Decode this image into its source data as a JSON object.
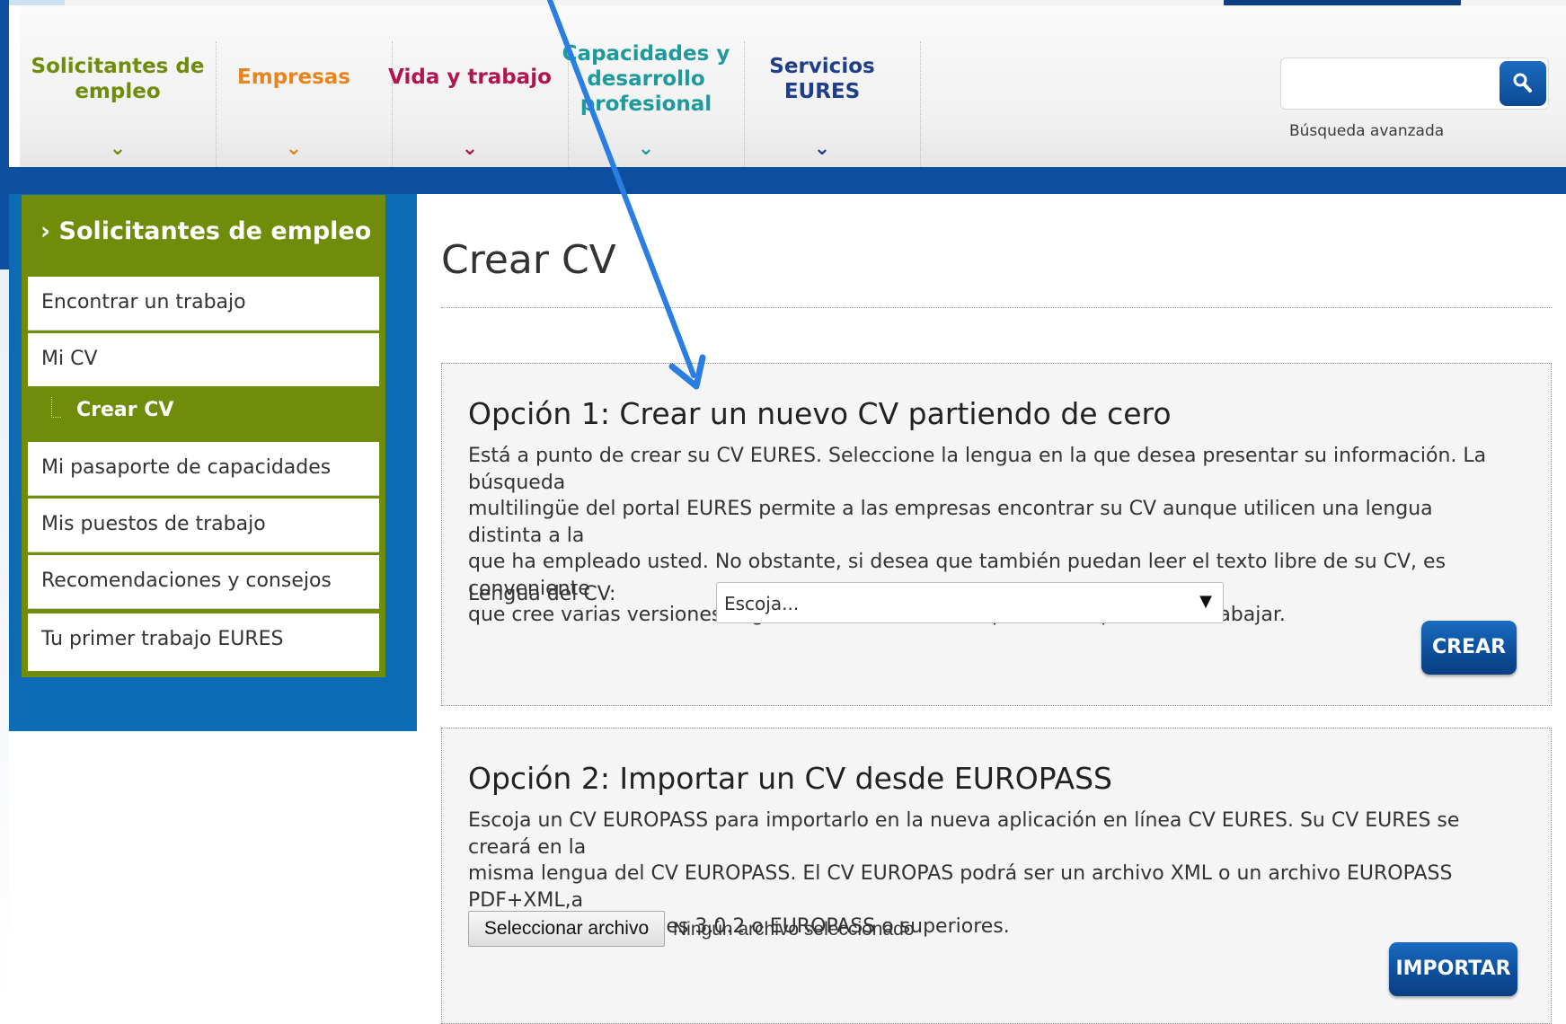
{
  "nav": {
    "items": [
      {
        "label_lines": [
          "Solicitantes de",
          "empleo"
        ],
        "color": "#6f8c0a"
      },
      {
        "label_lines": [
          "Empresas"
        ],
        "color": "#e7841d"
      },
      {
        "label_lines": [
          "Vida y trabajo"
        ],
        "color": "#b0154f"
      },
      {
        "label_lines": [
          "Capacidades y",
          "desarrollo",
          "profesional"
        ],
        "color": "#1f9a9c"
      },
      {
        "label_lines": [
          "Servicios",
          "EURES"
        ],
        "color": "#1e3d8a"
      }
    ],
    "chevron": "⌄"
  },
  "search": {
    "placeholder": "",
    "value": "",
    "advanced_link": "Búsqueda avanzada",
    "icon": "search-icon"
  },
  "sidebar": {
    "title": "Solicitantes de empleo",
    "title_prefix": "›",
    "items": [
      {
        "label": "Encontrar un trabajo"
      },
      {
        "label": "Mi CV"
      },
      {
        "label": "Crear CV",
        "active": true
      },
      {
        "label": "Mi pasaporte de capacidades"
      },
      {
        "label": "Mis puestos de trabajo"
      },
      {
        "label": "Recomendaciones y consejos"
      },
      {
        "label": "Tu primer trabajo EURES"
      }
    ]
  },
  "main": {
    "title": "Crear CV",
    "option1": {
      "title": "Opción 1: Crear un nuevo CV partiendo de cero",
      "lines": [
        "Está a punto de crear su CV EURES. Seleccione la lengua en la que desea presentar su información. La búsqueda",
        "multilingüe del portal EURES permite a las empresas encontrar su CV aunque utilicen una lengua distinta a la",
        "que ha empleado usted. No obstante, si desea que también puedan leer el texto libre de su CV, es conveniente",
        "que cree varias versiones lingüísticas en función del país en el que desee trabajar."
      ],
      "language_label": "Lengua del CV:",
      "language_select_value": "Escoja...",
      "create_button": "CREAR"
    },
    "option2": {
      "title": "Opción 2: Importar un CV desde EUROPASS",
      "lines": [
        "Escoja un CV EUROPASS para importarlo en la nueva aplicación en línea CV EURES. Su CV EURES se creará en la",
        "misma lengua del CV EUROPASS. El CV EUROPAS podrá ser un archivo XML o un archivo EUROPASS PDF+XML,a",
        "partir de las versiones 3.0.2 o EUROPASS o superiores."
      ],
      "file_button": "Seleccionar archivo",
      "file_status": "Ningún archivo seleccionado",
      "import_button": "IMPORTAR"
    }
  },
  "colors": {
    "brand_blue": "#0b4f9e",
    "sidebar_green": "#6f8c0a",
    "annotation_arrow": "#2a7de1"
  }
}
